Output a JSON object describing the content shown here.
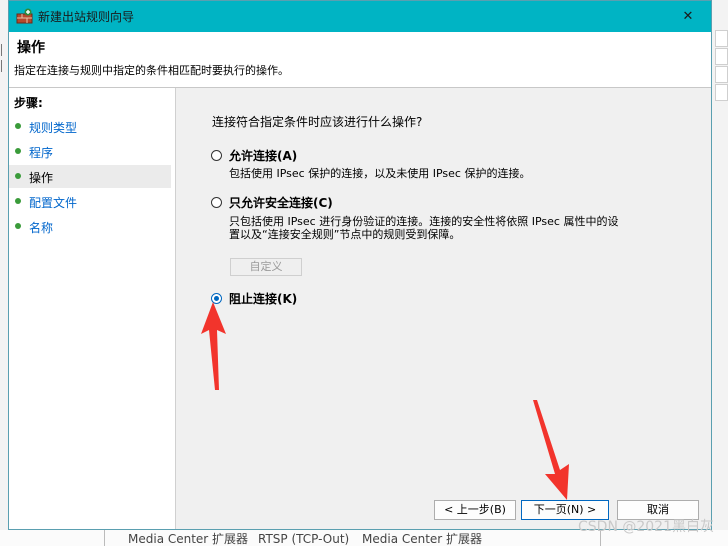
{
  "window": {
    "title": "新建出站规则向导",
    "close_glyph": "✕"
  },
  "header": {
    "title": "操作",
    "description": "指定在连接与规则中指定的条件相匹配时要执行的操作。"
  },
  "steps": {
    "title": "步骤:",
    "items": [
      {
        "label": "规则类型",
        "active": false
      },
      {
        "label": "程序",
        "active": false
      },
      {
        "label": "操作",
        "active": true
      },
      {
        "label": "配置文件",
        "active": false
      },
      {
        "label": "名称",
        "active": false
      }
    ]
  },
  "main": {
    "question": "连接符合指定条件时应该进行什么操作?",
    "options": [
      {
        "label": "允许连接(A)",
        "description": "包括使用 IPsec 保护的连接，以及未使用 IPsec 保护的连接。",
        "checked": false
      },
      {
        "label": "只允许安全连接(C)",
        "description_line1": "只包括使用 IPsec 进行身份验证的连接。连接的安全性将依照 IPsec 属性中的设",
        "description_line2": "置以及“连接安全规则”节点中的规则受到保障。",
        "checked": false
      },
      {
        "label": "阻止连接(K)",
        "checked": true
      }
    ],
    "customize_label": "自定义"
  },
  "buttons": {
    "back": "< 上一步(B)",
    "next": "下一页(N) >",
    "cancel": "取消"
  },
  "background": {
    "bottom_text_1": "Media Center 扩展器",
    "bottom_text_2": "RTSP (TCP-Out)",
    "bottom_text_3": "Media Center 扩展器"
  },
  "watermark": "CSDN @2021黑白灰",
  "colors": {
    "titlebar": "#00b4c4",
    "accent": "#0067c0",
    "link": "#0066cc",
    "arrow": "#f2342c"
  }
}
